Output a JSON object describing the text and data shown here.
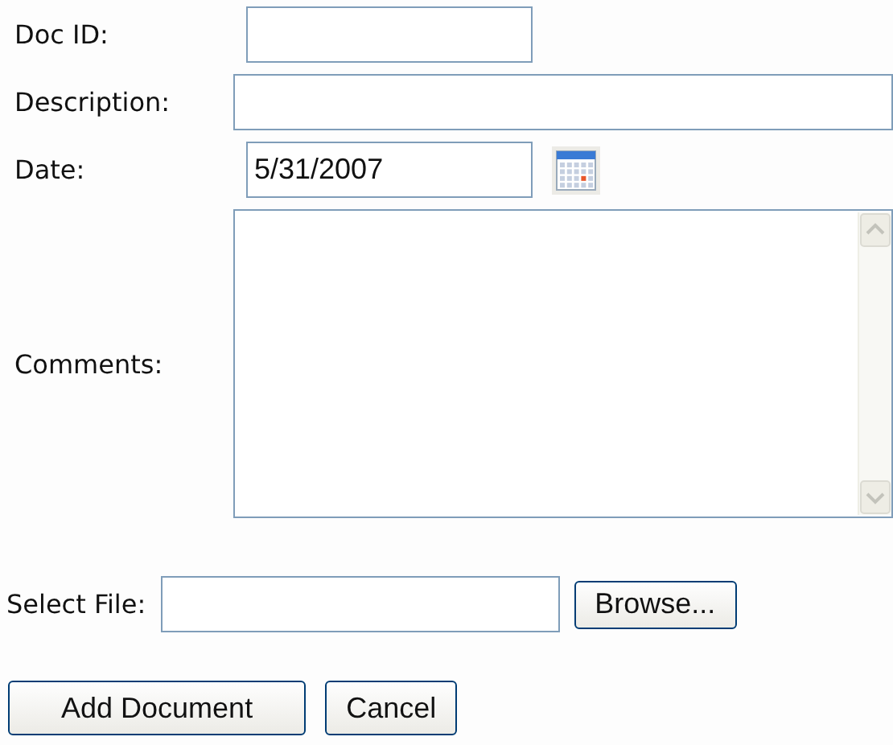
{
  "form": {
    "fields": [
      {
        "kind": "text",
        "label": "Doc ID:"
      },
      {
        "kind": "wide",
        "label": "Description:"
      },
      {
        "kind": "date",
        "label": "Date:",
        "value": "5/31/2007"
      },
      {
        "kind": "textarea",
        "label": "Comments:"
      }
    ]
  },
  "file": {
    "label": "Select File:",
    "button": "Browse..."
  },
  "buttons": [
    "Add Document",
    "Cancel"
  ]
}
